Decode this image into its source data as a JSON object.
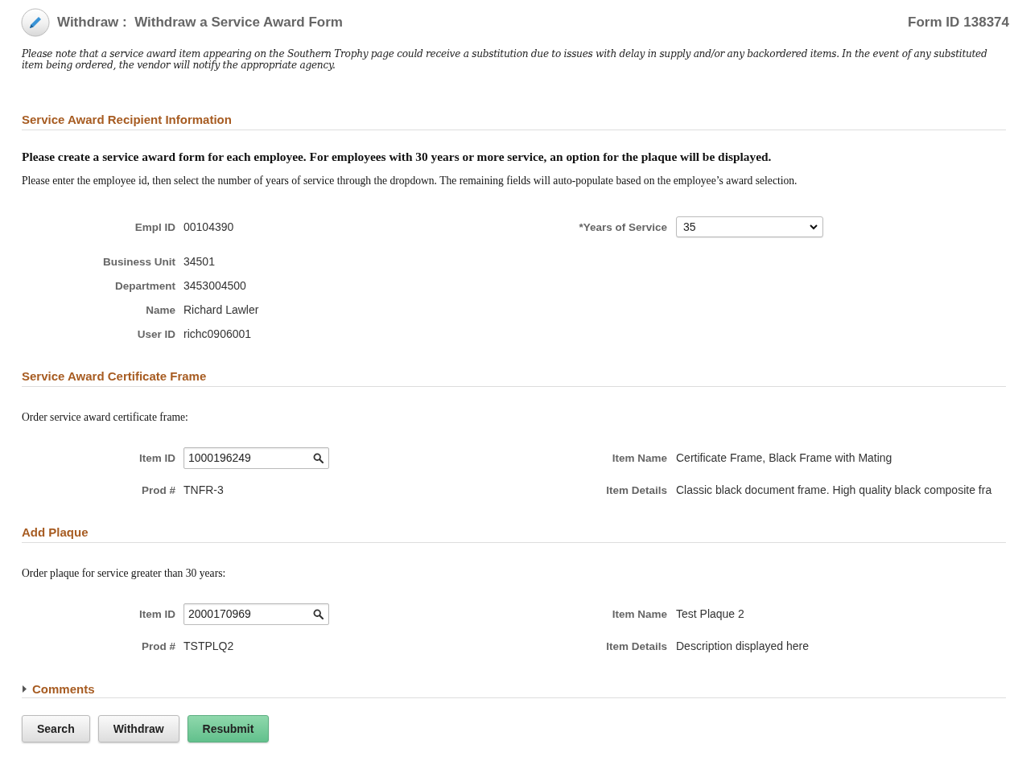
{
  "header": {
    "title": "Withdraw :  Withdraw a Service Award Form",
    "form_id_label": "Form ID",
    "form_id": "138374"
  },
  "notice": "Please note that a service award item appearing on the Southern Trophy page could receive a substitution due to issues with delay in supply and/or any backordered items. In the event of any substituted item being ordered, the vendor will notify the appropriate agency.",
  "recipient": {
    "title": "Service Award Recipient Information",
    "instruction_bold": "Please create a service award form for each employee. For employees with 30 years or more service, an option for the plaque will be displayed.",
    "instruction": "Please enter the employee id, then select the number of years of service through the dropdown. The remaining fields will auto-populate based on the employee’s award selection.",
    "empl_id": {
      "label": "Empl ID",
      "value": "00104390"
    },
    "fields": [
      {
        "label": "Business Unit",
        "value": "34501"
      },
      {
        "label": "Department",
        "value": "3453004500"
      },
      {
        "label": "Name",
        "value": "Richard Lawler"
      },
      {
        "label": "User ID",
        "value": "richc0906001"
      }
    ],
    "years": {
      "label": "*Years of Service",
      "value": "35"
    }
  },
  "items": [
    {
      "title": "Service Award Certificate Frame",
      "intro": "Order service award certificate frame:",
      "item_id": {
        "label": "Item ID",
        "value": "1000196249"
      },
      "prod": {
        "label": "Prod #",
        "value": "TNFR-3"
      },
      "item_name": {
        "label": "Item Name",
        "value": "Certificate Frame, Black Frame with Mating"
      },
      "item_details": {
        "label": "Item Details",
        "value": "Classic black document frame. High quality black composite fra"
      }
    },
    {
      "title": "Add Plaque",
      "intro": "Order plaque for service greater than 30 years:",
      "item_id": {
        "label": "Item ID",
        "value": "2000170969"
      },
      "prod": {
        "label": "Prod #",
        "value": "TSTPLQ2"
      },
      "item_name": {
        "label": "Item Name",
        "value": "Test Plaque 2"
      },
      "item_details": {
        "label": "Item Details",
        "value": "Description displayed here"
      }
    }
  ],
  "comments": {
    "title": "Comments",
    "expanded": false
  },
  "buttons": [
    {
      "label": "Search",
      "kind": "default"
    },
    {
      "label": "Withdraw",
      "kind": "default"
    },
    {
      "label": "Resubmit",
      "kind": "primary"
    }
  ]
}
